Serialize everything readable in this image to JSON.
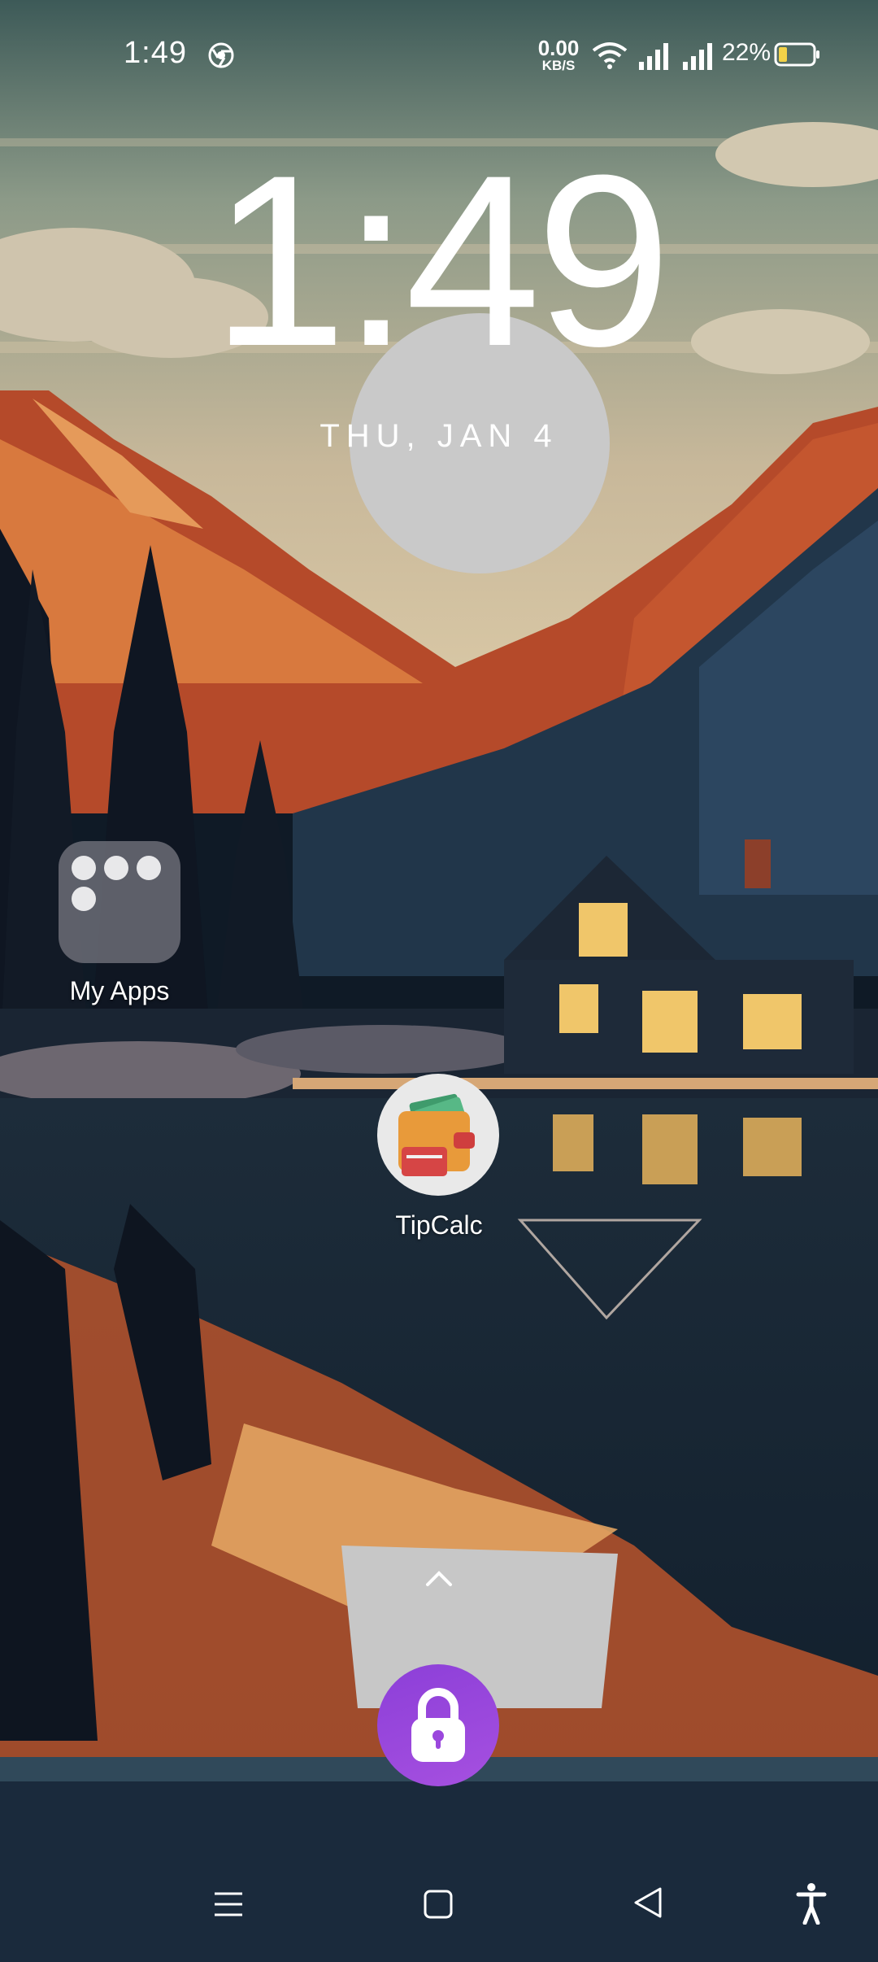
{
  "status_bar": {
    "time": "1:49",
    "net_speed_value": "0.00",
    "net_speed_unit": "KB/S",
    "battery_percent": "22%",
    "icons": [
      "chrome-icon",
      "wifi-icon",
      "signal-icon",
      "signal-icon",
      "battery-icon"
    ]
  },
  "lock_screen": {
    "clock": "1:49",
    "date": "THU, JAN 4"
  },
  "home_items": {
    "folder": {
      "label": "My Apps",
      "icons": [
        "robot-icon",
        "rocket-icon",
        "game-controller-icon",
        "lightbulb-icon"
      ]
    },
    "app": {
      "label": "TipCalc",
      "icon": "wallet-icon"
    }
  },
  "unlock": {
    "hint_icon": "chevron-up-icon",
    "button_icon": "lock-icon",
    "accent": "#9b47dd"
  },
  "nav_bar": {
    "icons": [
      "menu-icon",
      "home-icon",
      "back-icon",
      "accessibility-icon"
    ]
  }
}
